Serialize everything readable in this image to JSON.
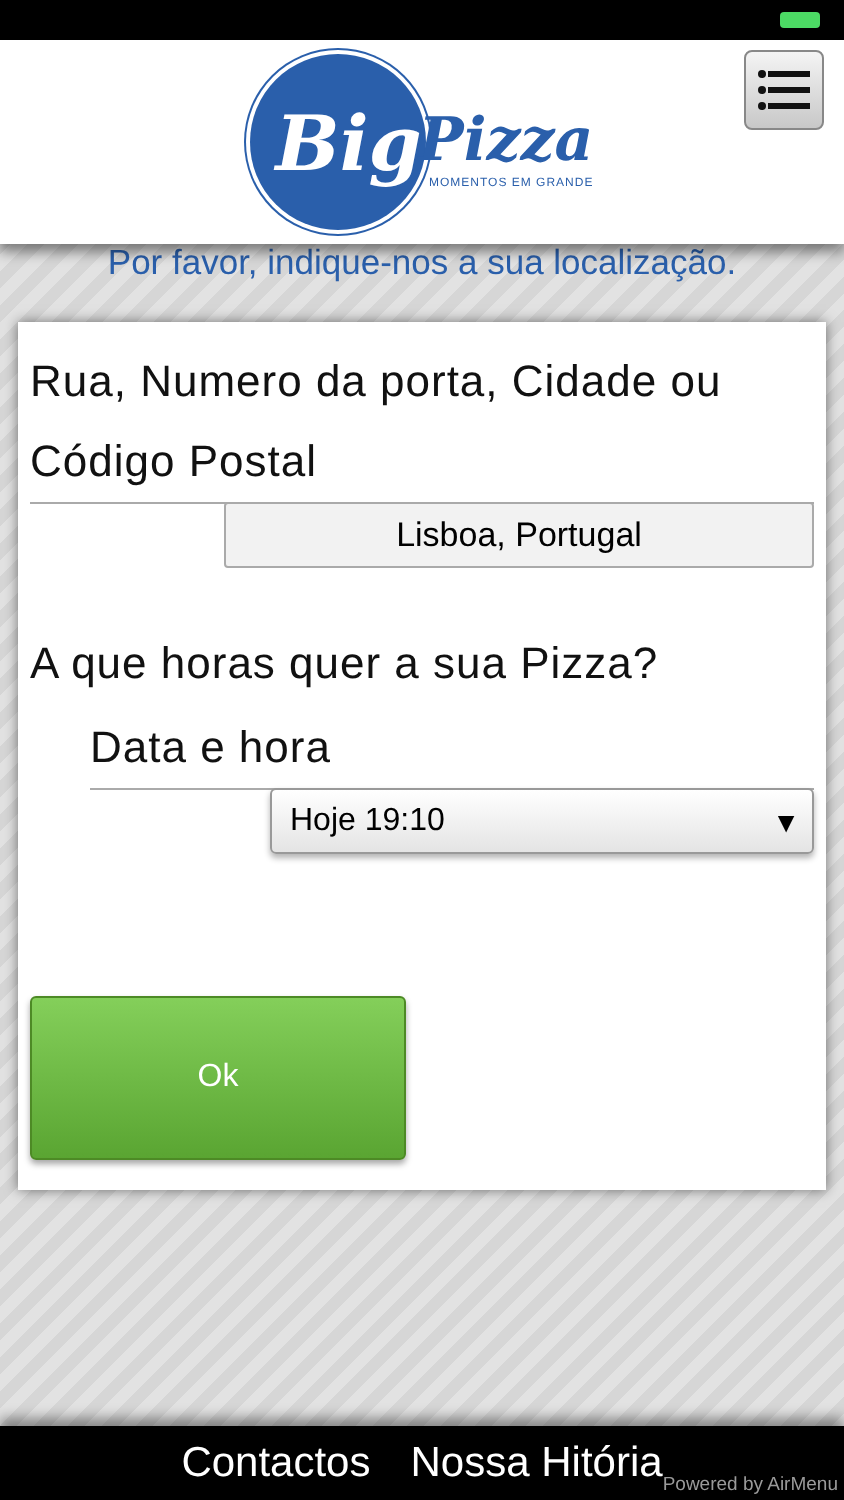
{
  "header": {
    "logo": {
      "word_1": "Big",
      "word_2": "Pizza",
      "tagline": "MOMENTOS EM GRANDE"
    }
  },
  "subtitle": "Por favor, indique-nos a sua localização.",
  "form": {
    "address_label": "Rua, Numero da porta, Cidade ou Código Postal",
    "address_value": "Lisboa, Portugal",
    "time_question": "A que horas quer a sua Pizza?",
    "datetime_label": "Data e hora",
    "datetime_value": "Hoje 19:10",
    "datetime_arrow": "▼",
    "submit": "Ok"
  },
  "footer": {
    "links": [
      "Contactos",
      "Nossa Hitória"
    ],
    "powered_by": "Powered by AirMenu"
  }
}
